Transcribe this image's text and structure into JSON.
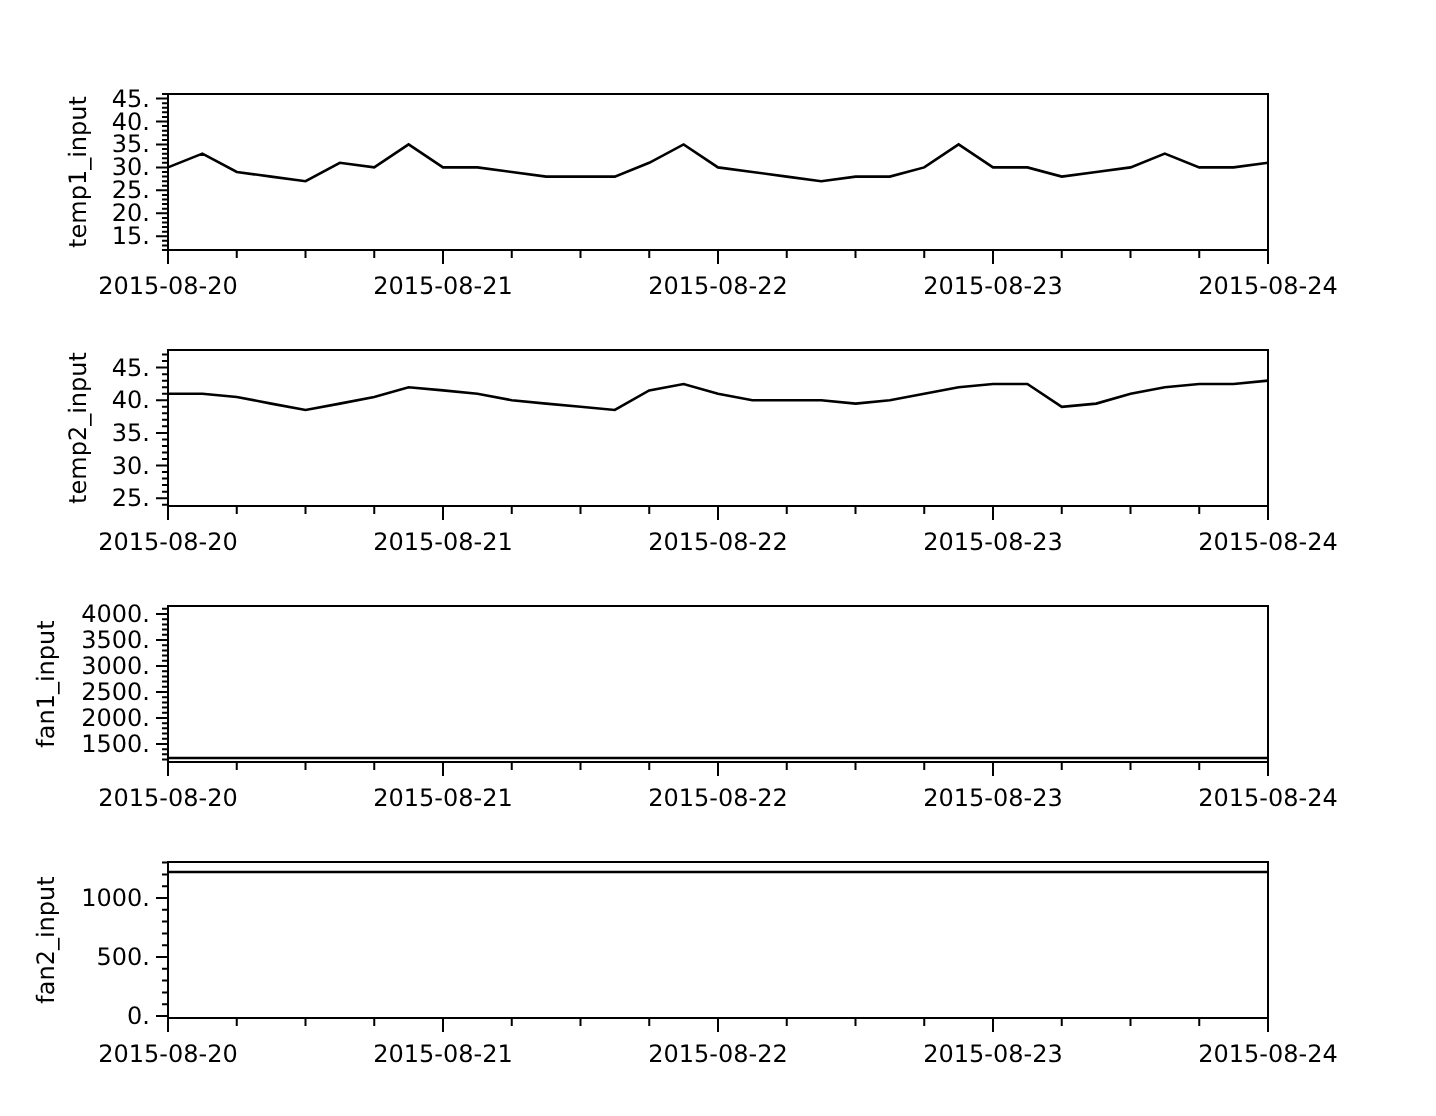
{
  "charts": [
    {
      "chart_data": {
        "type": "line",
        "ylabel": "temp1_input",
        "ylim": [
          12,
          46
        ],
        "categories": [
          "2015-08-20",
          null,
          null,
          null,
          null,
          null,
          null,
          null,
          "2015-08-21",
          null,
          null,
          null,
          null,
          null,
          null,
          null,
          "2015-08-22",
          null,
          null,
          null,
          null,
          null,
          null,
          null,
          "2015-08-23",
          null,
          null,
          null,
          null,
          null,
          null,
          null,
          "2015-08-24"
        ],
        "series": [
          {
            "color": "#000000",
            "values": [
              30,
              33,
              29,
              28,
              27,
              31,
              30,
              35,
              30,
              30,
              29,
              28,
              28,
              28,
              31,
              35,
              30,
              29,
              28,
              27,
              28,
              28,
              30,
              35,
              30,
              30,
              28,
              29,
              30,
              33,
              30,
              30,
              31
            ]
          }
        ],
        "yticks": [
          {
            "value": 15,
            "label": "15."
          },
          {
            "value": 20,
            "label": "20."
          },
          {
            "value": 25,
            "label": "25."
          },
          {
            "value": 30,
            "label": "30."
          },
          {
            "value": 35,
            "label": "35."
          },
          {
            "value": 40,
            "label": "40."
          },
          {
            "value": 45,
            "label": "45."
          }
        ]
      }
    },
    {
      "chart_data": {
        "type": "line",
        "ylabel": "temp2_input",
        "ylim": [
          23.8,
          47.7
        ],
        "categories": [
          "2015-08-20",
          null,
          null,
          null,
          null,
          null,
          null,
          null,
          "2015-08-21",
          null,
          null,
          null,
          null,
          null,
          null,
          null,
          "2015-08-22",
          null,
          null,
          null,
          null,
          null,
          null,
          null,
          "2015-08-23",
          null,
          null,
          null,
          null,
          null,
          null,
          null,
          "2015-08-24"
        ],
        "series": [
          {
            "color": "#000000",
            "values": [
              41,
              41,
              40.5,
              39.5,
              38.5,
              39.5,
              40.5,
              42,
              41.5,
              41,
              40,
              39.5,
              39,
              38.5,
              41.5,
              42.5,
              41,
              40,
              40,
              40,
              39.5,
              40,
              41,
              42,
              42.5,
              42.5,
              39,
              39.5,
              41,
              42,
              42.5,
              42.5,
              43
            ]
          }
        ],
        "yticks": [
          {
            "value": 25,
            "label": "25."
          },
          {
            "value": 30,
            "label": "30."
          },
          {
            "value": 35,
            "label": "35."
          },
          {
            "value": 40,
            "label": "40."
          },
          {
            "value": 45,
            "label": "45."
          }
        ]
      }
    },
    {
      "chart_data": {
        "type": "line",
        "ylabel": "fan1_input",
        "ylim": [
          1153,
          4154
        ],
        "categories": [
          "2015-08-20",
          "2015-08-21",
          "2015-08-22",
          "2015-08-23",
          "2015-08-24"
        ],
        "series": [
          {
            "color": "#000000",
            "values": [
              1230,
              1230,
              1230,
              1230,
              1230
            ]
          }
        ],
        "yticks": [
          {
            "value": 1500,
            "label": "1500."
          },
          {
            "value": 2000,
            "label": "2000."
          },
          {
            "value": 2500,
            "label": "2500."
          },
          {
            "value": 3000,
            "label": "3000."
          },
          {
            "value": 3500,
            "label": "3500."
          },
          {
            "value": 4000,
            "label": "4000."
          }
        ]
      }
    },
    {
      "chart_data": {
        "type": "line",
        "ylabel": "fan2_input",
        "ylim": [
          -17,
          1305
        ],
        "categories": [
          "2015-08-20",
          "2015-08-21",
          "2015-08-22",
          "2015-08-23",
          "2015-08-24"
        ],
        "series": [
          {
            "color": "#000000",
            "values": [
              1220,
              1220,
              1220,
              1220,
              1220
            ]
          }
        ],
        "yticks": [
          {
            "value": 0,
            "label": "0."
          },
          {
            "value": 500,
            "label": "500."
          },
          {
            "value": 1000,
            "label": "1000."
          }
        ]
      }
    }
  ]
}
